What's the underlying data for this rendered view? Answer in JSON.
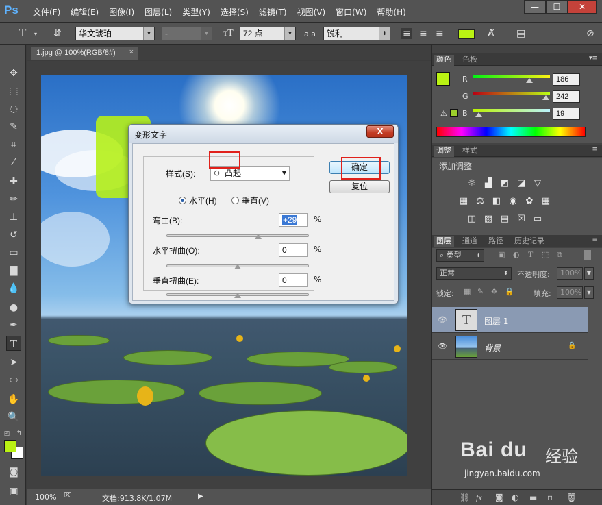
{
  "app": {
    "logo": "Ps",
    "menu": [
      "文件(F)",
      "编辑(E)",
      "图像(I)",
      "图层(L)",
      "类型(Y)",
      "选择(S)",
      "滤镜(T)",
      "视图(V)",
      "窗口(W)",
      "帮助(H)"
    ],
    "window_controls": {
      "minimize": "—",
      "maximize": "☐",
      "close": "✕"
    }
  },
  "options_bar": {
    "font_family": "华文琥珀",
    "font_style": "-",
    "font_size": "72 点",
    "aa_label": "a a",
    "anti_alias": "锐利",
    "text_color": "#baf213"
  },
  "document": {
    "tab_label": "1.jpg @ 100%(RGB/8#)",
    "tab_close": "×",
    "zoom": "100%",
    "doc_info": "文档:913.8K/1.07M"
  },
  "tools": {
    "foreground_color": "#baf213",
    "background_color": "#ffffff"
  },
  "color_panel": {
    "tabs": [
      "颜色",
      "色板"
    ],
    "r_label": "R",
    "g_label": "G",
    "b_label": "B",
    "r": "186",
    "g": "242",
    "b": "19",
    "r_fraction": 0.73,
    "g_fraction": 0.95,
    "b_fraction": 0.07
  },
  "adjust_panel": {
    "tabs": [
      "调整",
      "样式"
    ],
    "title": "添加调整"
  },
  "layers_panel": {
    "tabs": [
      "图层",
      "通道",
      "路径",
      "历史记录"
    ],
    "filter_kind": "类型",
    "blend_mode": "正常",
    "opacity_label": "不透明度:",
    "opacity": "100%",
    "lock_label": "锁定:",
    "fill_label": "填充:",
    "fill": "100%",
    "layers": [
      {
        "name": "图层 1",
        "thumb": "T",
        "selected": true
      },
      {
        "name": "背景",
        "thumb": "",
        "selected": false
      }
    ],
    "footer_icons": [
      "link-icon",
      "fx-icon",
      "mask-icon",
      "adjustment-icon",
      "folder-icon",
      "new-layer-icon",
      "trash-icon"
    ]
  },
  "dialog": {
    "title": "变形文字",
    "close": "X",
    "style_label": "样式(S):",
    "style_value": "凸起",
    "horizontal_label": "水平(H)",
    "vertical_label": "垂直(V)",
    "orientation": "horizontal",
    "bend_label": "弯曲(B):",
    "bend_value": "+29",
    "bend_fraction": 0.645,
    "h_distort_label": "水平扭曲(O):",
    "h_distort_value": "0",
    "h_distort_fraction": 0.5,
    "v_distort_label": "垂直扭曲(E):",
    "v_distort_value": "0",
    "v_distort_fraction": 0.5,
    "percent": "%",
    "ok_label": "确定",
    "reset_label": "复位",
    "highlight_color": "#e0211b"
  },
  "watermark": {
    "logo": "Bai du",
    "site_name": "经验",
    "url": "jingyan.baidu.com"
  }
}
